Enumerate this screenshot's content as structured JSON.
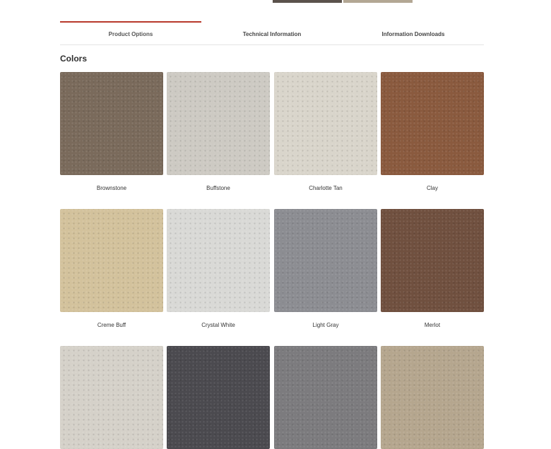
{
  "header": {
    "thumbnails": [
      {
        "name": "gallery-thumb-1",
        "color": "#5b524c"
      },
      {
        "name": "gallery-thumb-2",
        "color": "#b3a794"
      }
    ]
  },
  "tabs": [
    {
      "label": "Product Options",
      "active": true
    },
    {
      "label": "Technical Information",
      "active": false
    },
    {
      "label": "Information Downloads",
      "active": false
    }
  ],
  "accent_color": "#b8392b",
  "colors_section": {
    "title": "Colors",
    "swatches": [
      {
        "label": "Brownstone",
        "color": "#7a6a5b"
      },
      {
        "label": "Buffstone",
        "color": "#cdcac3"
      },
      {
        "label": "Charlotte Tan",
        "color": "#d9d5cb"
      },
      {
        "label": "Clay",
        "color": "#8a5a3e"
      },
      {
        "label": "Creme Buff",
        "color": "#d3c29c"
      },
      {
        "label": "Crystal White",
        "color": "#d9d9d6"
      },
      {
        "label": "Light Gray",
        "color": "#8c8d92"
      },
      {
        "label": "Merlot",
        "color": "#70503f"
      },
      {
        "label": "",
        "color": "#d5d1c9"
      },
      {
        "label": "",
        "color": "#4b4a4f"
      },
      {
        "label": "",
        "color": "#7c7b7e"
      },
      {
        "label": "",
        "color": "#b5a68e"
      }
    ]
  }
}
